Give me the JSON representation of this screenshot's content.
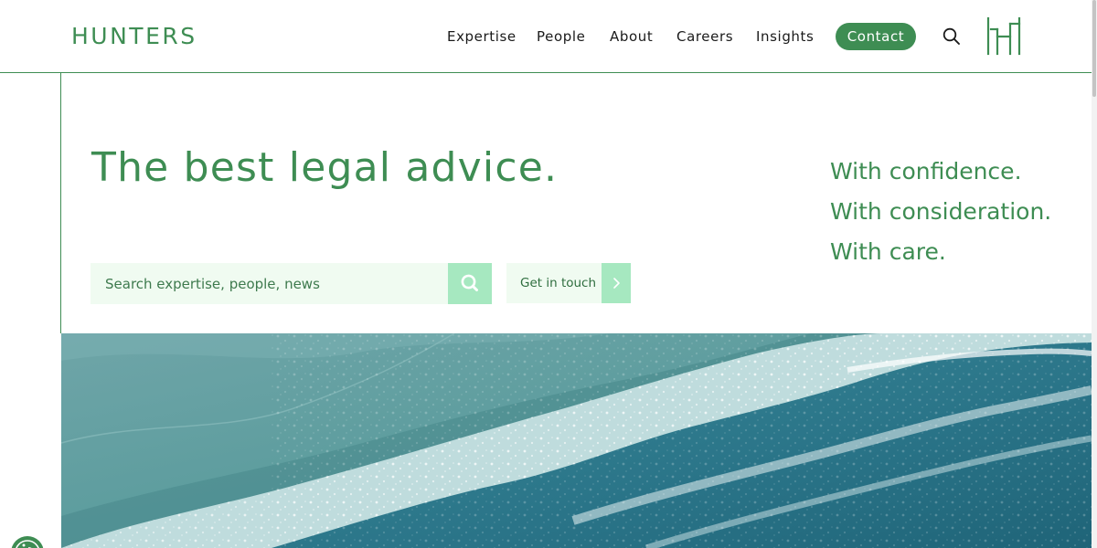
{
  "header": {
    "logo": "HUNTERS",
    "nav": [
      "Expertise",
      "People",
      "About",
      "Careers",
      "Insights"
    ],
    "contact_label": "Contact"
  },
  "hero": {
    "headline": "The best legal advice.",
    "taglines": [
      "With confidence.",
      "With consideration.",
      "With care."
    ],
    "search_placeholder": "Search expertise, people, news",
    "touch_label": "Get in touch"
  },
  "colors": {
    "brand_green": "#3e8d53",
    "pale_green": "#f0fbf1",
    "mint": "#a6e8c0",
    "ocean_deep": "#2a7488",
    "sand_teal": "#5b9c9d"
  },
  "icons": [
    "search-icon",
    "monogram-logo",
    "chevron-right-icon",
    "accessibility-icon"
  ]
}
